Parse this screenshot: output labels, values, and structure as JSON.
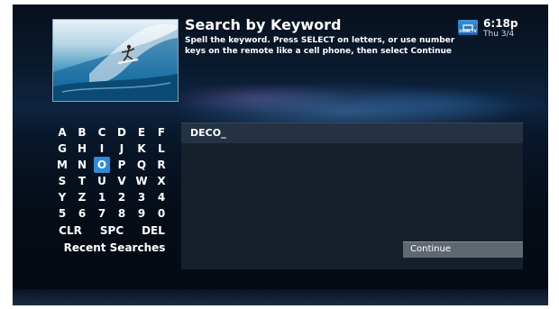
{
  "header": {
    "title": "Search by Keyword",
    "instructions": "Spell the keyword. Press SELECT on letters, or use number keys on the remote like a cell phone, then select Continue"
  },
  "status": {
    "logo_text": "DIRECTV",
    "time": "6:18p",
    "date": "Thu 3/4"
  },
  "thumbnail": {
    "icon": "surfer-image"
  },
  "keyboard": {
    "rows": [
      [
        "A",
        "B",
        "C",
        "D",
        "E",
        "F"
      ],
      [
        "G",
        "H",
        "I",
        "J",
        "K",
        "L"
      ],
      [
        "M",
        "N",
        "O",
        "P",
        "Q",
        "R"
      ],
      [
        "S",
        "T",
        "U",
        "V",
        "W",
        "X"
      ],
      [
        "Y",
        "Z",
        "1",
        "2",
        "3",
        "4"
      ],
      [
        "5",
        "6",
        "7",
        "8",
        "9",
        "0"
      ]
    ],
    "selected": "O",
    "clear_label": "CLR",
    "space_label": "SPC",
    "delete_label": "DEL",
    "recent_label": "Recent Searches"
  },
  "search": {
    "entry": "DECO_"
  },
  "continue_label": "Continue",
  "colors": {
    "accent": "#2e8ad6",
    "background": "#050c16"
  }
}
